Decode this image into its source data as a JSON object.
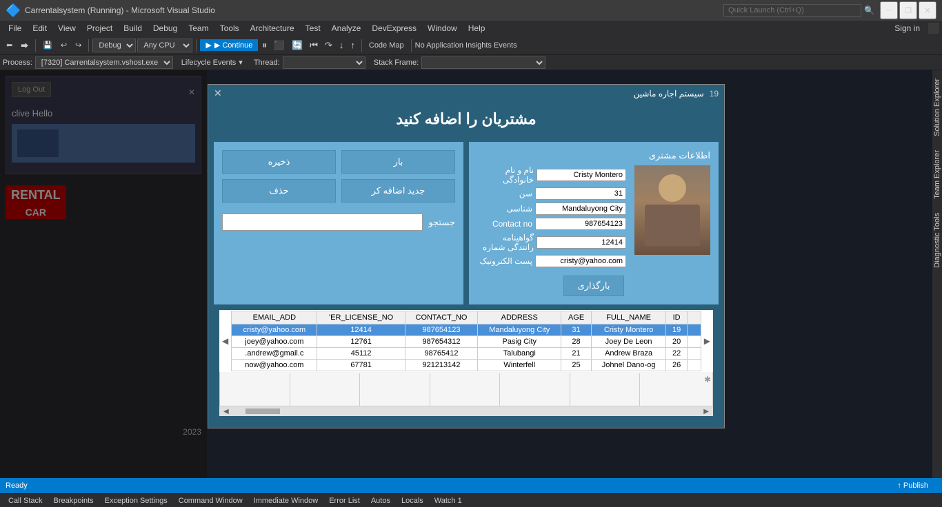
{
  "titleBar": {
    "title": "Carrentalsystem (Running) - Microsoft Visual Studio",
    "searchPlaceholder": "Quick Launch (Ctrl+Q)",
    "buttons": {
      "minimize": "─",
      "restore": "❐",
      "close": "✕"
    }
  },
  "menuBar": {
    "items": [
      "File",
      "Edit",
      "View",
      "Project",
      "Build",
      "Debug",
      "Team",
      "Tools",
      "Architecture",
      "Test",
      "Analyze",
      "DevExpress",
      "Window",
      "Help"
    ]
  },
  "toolbar": {
    "debug": "Debug",
    "anyCpu": "Any CPU",
    "continue": "▶ Continue",
    "codemap": "Code Map",
    "noInsights": "No Application Insights Events"
  },
  "processBar": {
    "process": "Process:",
    "processValue": "[7320] Carrentalsystem.vshost.exe",
    "lifecycle": "Lifecycle Events",
    "thread": "Thread:",
    "stackFrame": "Stack Frame:"
  },
  "modal": {
    "closeBtn": "✕",
    "number": "19",
    "title": "مشتریان را اضافه کنید",
    "sideTitle": "سیستم اجاره ماشین",
    "year": "2023",
    "buttons": {
      "save": "ذخیره",
      "load": "بار",
      "delete": "حذف",
      "addNew": "جدید اضافه کر"
    },
    "searchLabel": "جستجو",
    "searchPlaceholder": "",
    "uploadBtn": "بارگذاری",
    "infoSection": {
      "title": "اطلاعات مشتری",
      "nameLabel": "نام و نام خانوادگی",
      "nameValue": "Cristy Montero",
      "ageLabel": "سن",
      "ageValue": "31",
      "cityLabel": "شناسی",
      "cityValue": "Mandaluyong City",
      "contactLabel": "Contact no",
      "contactValue": "987654123",
      "licenseLabel": "گواهینامه رانندگی شماره",
      "licenseValue": "12414",
      "emailLabel": "پست الکترونیک",
      "emailValue": "cristy@yahoo.com"
    },
    "table": {
      "columns": [
        "EMAIL_ADD",
        "'ER_LICENSE_NO",
        "CONTACT_NO",
        "ADDRESS",
        "AGE",
        "FULL_NAME",
        "ID"
      ],
      "rows": [
        {
          "email": "cristy@yahoo.com",
          "license": "12414",
          "contact": "987654123",
          "address": "Mandaluyong City",
          "age": "31",
          "name": "Cristy Montero",
          "id": "19",
          "selected": true
        },
        {
          "email": "joey@yahoo.com",
          "license": "12761",
          "contact": "987654312",
          "address": "Pasig City",
          "age": "28",
          "name": "Joey De Leon",
          "id": "20",
          "selected": false
        },
        {
          "email": ".andrew@gmail.c",
          "license": "45112",
          "contact": "98765412",
          "address": "Talubangi",
          "age": "21",
          "name": "Andrew Braza",
          "id": "22",
          "selected": false
        },
        {
          "email": "now@yahoo.com",
          "license": "67781",
          "contact": "921213142",
          "address": "Winterfell",
          "age": "25",
          "name": "Johnel Dano-og",
          "id": "26",
          "selected": false
        }
      ]
    }
  },
  "bgApp": {
    "logoutBtn": "Log Out",
    "userName": "clive  Hello",
    "rentalLogo": "RENTAL",
    "rentalCar": "CAR",
    "year": "2023"
  },
  "rightPanels": {
    "solution": "Solution Explorer",
    "team": "Team Explorer",
    "diagnostic": "Diagnostic Tools"
  },
  "bottomTabs": {
    "callStack": "Call Stack",
    "breakpoints": "Breakpoints",
    "exceptionSettings": "Exception Settings",
    "commandWindow": "Command Window",
    "immediateWindow": "Immediate Window",
    "errorList": "Error List",
    "autos": "Autos",
    "locals": "Locals",
    "watch1": "Watch 1"
  },
  "statusBar": {
    "ready": "Ready",
    "publish": "↑ Publish"
  }
}
